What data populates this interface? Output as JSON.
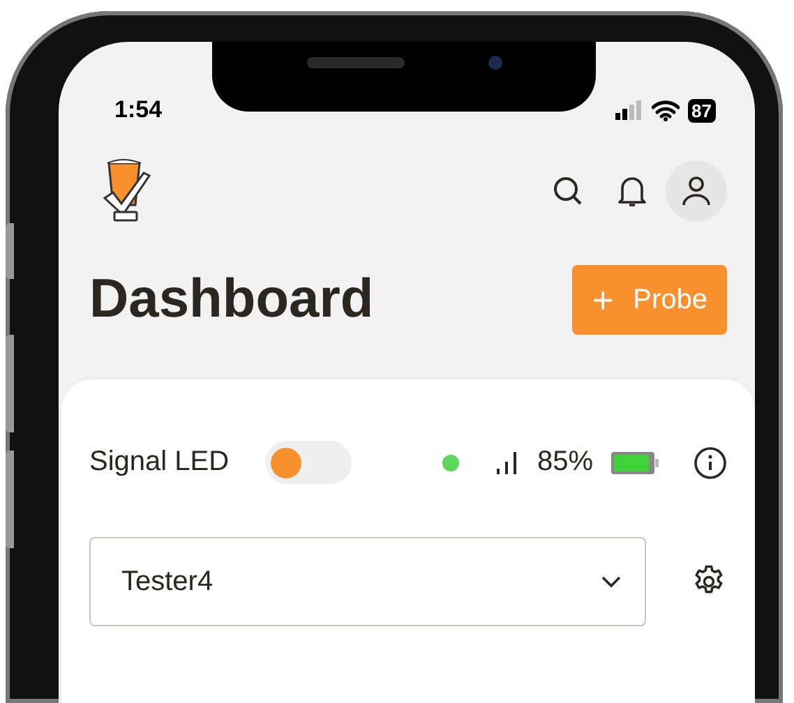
{
  "status_bar": {
    "time": "1:54",
    "battery": "87"
  },
  "header": {
    "title": "Dashboard",
    "add_button": {
      "icon": "+",
      "label": "Probe"
    }
  },
  "device_card": {
    "led": {
      "label": "Signal LED",
      "on": false
    },
    "status_dot": {
      "color": "#5cd65c"
    },
    "battery_reading": "85%",
    "device_select": {
      "value": "Tester4"
    }
  }
}
